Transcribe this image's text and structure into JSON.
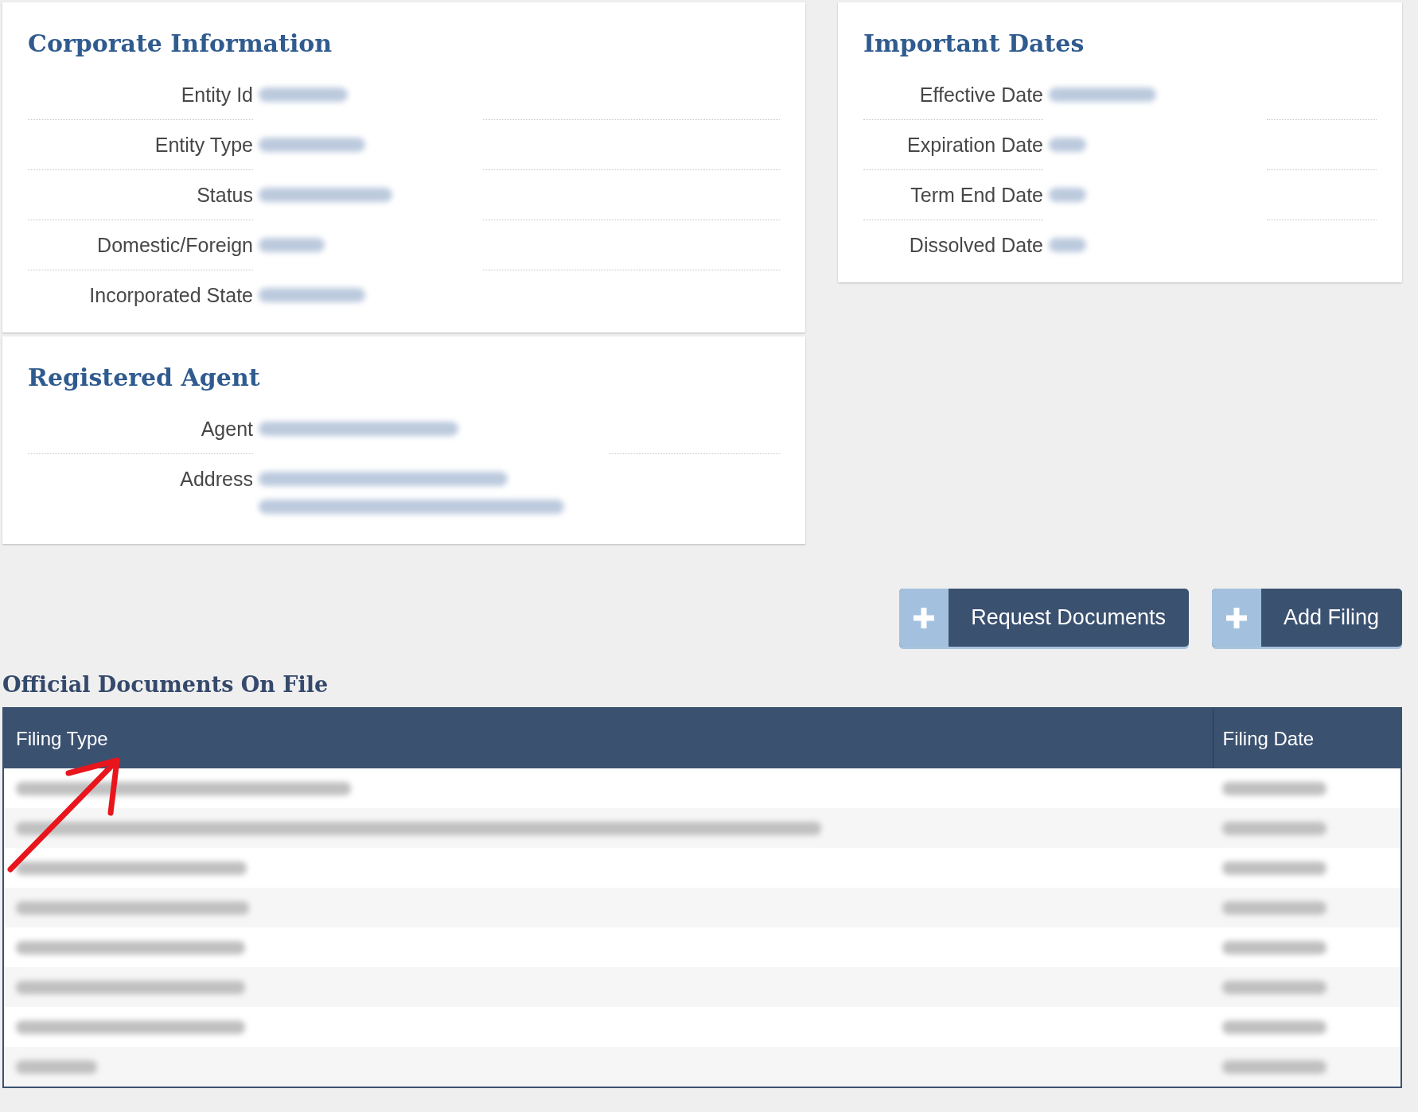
{
  "corporate_information": {
    "title": "Corporate Information",
    "fields": [
      {
        "label": "Entity Id",
        "blurred": true
      },
      {
        "label": "Entity Type",
        "blurred": true
      },
      {
        "label": "Status",
        "blurred": true
      },
      {
        "label": "Domestic/Foreign",
        "blurred": true
      },
      {
        "label": "Incorporated State",
        "blurred": true
      }
    ]
  },
  "important_dates": {
    "title": "Important Dates",
    "fields": [
      {
        "label": "Effective Date",
        "blurred": true
      },
      {
        "label": "Expiration Date",
        "blurred": true
      },
      {
        "label": "Term End Date",
        "blurred": true
      },
      {
        "label": "Dissolved Date",
        "blurred": true
      }
    ]
  },
  "registered_agent": {
    "title": "Registered Agent",
    "fields": [
      {
        "label": "Agent",
        "kind": "single",
        "blurred": true
      },
      {
        "label": "Address",
        "kind": "multiline",
        "blurred": true
      }
    ]
  },
  "buttons": [
    "Request Documents",
    "Add Filing"
  ],
  "official_documents": {
    "title": "Official Documents On File",
    "table": {
      "columns": [
        "Filing Type",
        "Filing Date"
      ],
      "rows": [
        {
          "blurred": true
        },
        {
          "blurred": true
        },
        {
          "blurred": true
        },
        {
          "blurred": true
        },
        {
          "blurred": true
        },
        {
          "blurred": true
        },
        {
          "blurred": true
        },
        {
          "blurred": true
        }
      ]
    }
  },
  "annotations": [
    {
      "kind": "arrow"
    }
  ]
}
